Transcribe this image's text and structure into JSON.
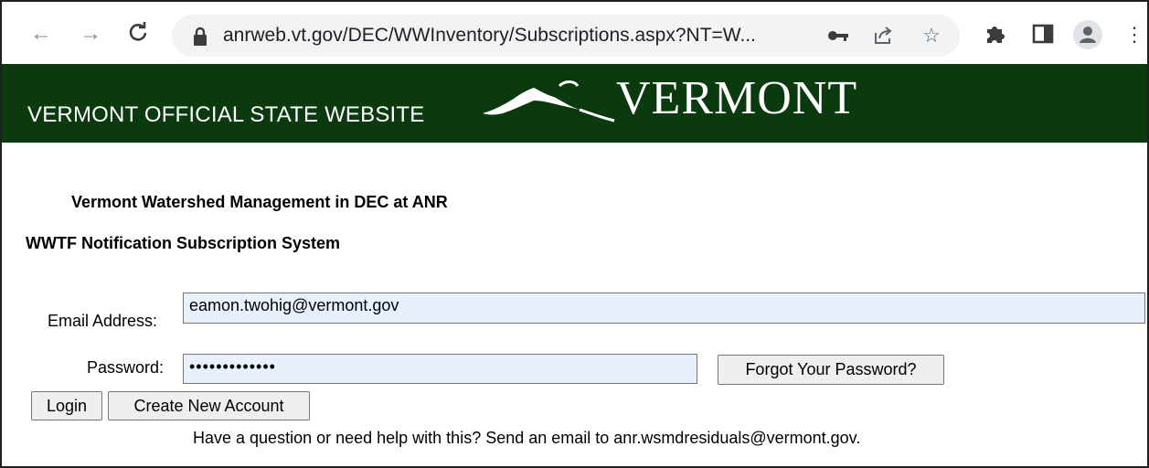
{
  "browser": {
    "url": "anrweb.vt.gov/DEC/WWInventory/Subscriptions.aspx?NT=W...",
    "icons": [
      "back-arrow-icon",
      "forward-arrow-icon",
      "reload-icon",
      "lock-icon",
      "key-icon",
      "share-icon",
      "star-icon",
      "extensions-icon",
      "side-panel-icon",
      "profile-avatar",
      "menu-dots-icon"
    ]
  },
  "banner": {
    "site_text": "VERMONT OFFICIAL STATE WEBSITE",
    "logo_text": "VERMONT",
    "background_color": "#0b3a0f"
  },
  "page": {
    "heading1": "Vermont Watershed Management in DEC at ANR",
    "heading2": "WWTF Notification Subscription System",
    "email_label": "Email Address:",
    "email_value": "eamon.twohig@vermont.gov",
    "password_label": "Password:",
    "password_value": "•••••••••••••",
    "forgot_button": "Forgot Your Password?",
    "login_button": "Login",
    "create_button": "Create New Account",
    "help_text": "Have a question or need help with this? Send an email to anr.wsmdresiduals@vermont.gov."
  }
}
